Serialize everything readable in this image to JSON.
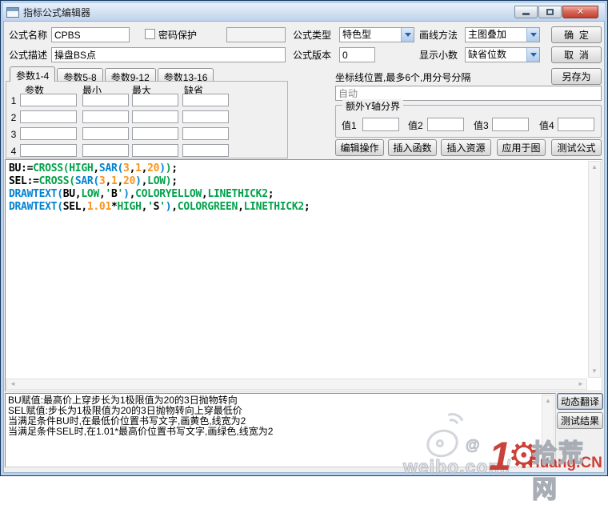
{
  "window": {
    "title": "指标公式编辑器"
  },
  "form": {
    "name_label": "公式名称",
    "name_value": "CPBS",
    "password_label": "密码保护",
    "password_value": "",
    "desc_label": "公式描述",
    "desc_value": "操盘BS点",
    "type_label": "公式类型",
    "type_value": "特色型",
    "draw_label": "画线方法",
    "draw_value": "主图叠加",
    "version_label": "公式版本",
    "version_value": "0",
    "decimal_label": "显示小数",
    "decimal_value": "缺省位数",
    "ok_label": "确  定",
    "cancel_label": "取  消",
    "saveas_label": "另存为"
  },
  "param_tabs": [
    {
      "label": "参数1-4",
      "active": true
    },
    {
      "label": "参数5-8",
      "active": false
    },
    {
      "label": "参数9-12",
      "active": false
    },
    {
      "label": "参数13-16",
      "active": false
    }
  ],
  "params": {
    "headers": [
      "参数",
      "最小",
      "最大",
      "缺省"
    ],
    "rows": [
      {
        "index": "1",
        "values": [
          "",
          "",
          "",
          ""
        ]
      },
      {
        "index": "2",
        "values": [
          "",
          "",
          "",
          ""
        ]
      },
      {
        "index": "3",
        "values": [
          "",
          "",
          "",
          ""
        ]
      },
      {
        "index": "4",
        "values": [
          "",
          "",
          "",
          ""
        ]
      }
    ]
  },
  "coord": {
    "hint": "坐标线位置,最多6个,用分号分隔",
    "value": "自动"
  },
  "ybound": {
    "title": "额外Y轴分界",
    "fields": [
      {
        "label": "值1",
        "value": ""
      },
      {
        "label": "值2",
        "value": ""
      },
      {
        "label": "值3",
        "value": ""
      },
      {
        "label": "值4",
        "value": ""
      }
    ]
  },
  "actions": [
    "编辑操作",
    "插入函数",
    "插入资源",
    "应用于图",
    "测试公式"
  ],
  "code": {
    "lines": [
      [
        {
          "c": "k",
          "t": "BU:="
        },
        {
          "c": "g",
          "t": "CROSS(HIGH"
        },
        {
          "c": "k",
          "t": ","
        },
        {
          "c": "b",
          "t": "SAR("
        },
        {
          "c": "o",
          "t": "3"
        },
        {
          "c": "k",
          "t": ","
        },
        {
          "c": "o",
          "t": "1"
        },
        {
          "c": "k",
          "t": ","
        },
        {
          "c": "o",
          "t": "20"
        },
        {
          "c": "b",
          "t": ")"
        },
        {
          "c": "g",
          "t": ")"
        },
        {
          "c": "k",
          "t": ";"
        }
      ],
      [
        {
          "c": "k",
          "t": "SEL:="
        },
        {
          "c": "g",
          "t": "CROSS("
        },
        {
          "c": "b",
          "t": "SAR("
        },
        {
          "c": "o",
          "t": "3"
        },
        {
          "c": "k",
          "t": ","
        },
        {
          "c": "o",
          "t": "1"
        },
        {
          "c": "k",
          "t": ","
        },
        {
          "c": "o",
          "t": "20"
        },
        {
          "c": "b",
          "t": ")"
        },
        {
          "c": "k",
          "t": ","
        },
        {
          "c": "g",
          "t": "LOW)"
        },
        {
          "c": "k",
          "t": ";"
        }
      ],
      [
        {
          "c": "b",
          "t": "DRAWTEXT("
        },
        {
          "c": "k",
          "t": "BU,"
        },
        {
          "c": "g",
          "t": "LOW"
        },
        {
          "c": "k",
          "t": ","
        },
        {
          "c": "g",
          "t": "'"
        },
        {
          "c": "k",
          "t": "B"
        },
        {
          "c": "g",
          "t": "'"
        },
        {
          "c": "b",
          "t": ")"
        },
        {
          "c": "k",
          "t": ","
        },
        {
          "c": "g",
          "t": "COLORYELLOW"
        },
        {
          "c": "k",
          "t": ","
        },
        {
          "c": "g",
          "t": "LINETHICK2"
        },
        {
          "c": "k",
          "t": ";"
        }
      ],
      [
        {
          "c": "b",
          "t": "DRAWTEXT("
        },
        {
          "c": "k",
          "t": "SEL,"
        },
        {
          "c": "o",
          "t": "1.01"
        },
        {
          "c": "k",
          "t": "*"
        },
        {
          "c": "g",
          "t": "HIGH"
        },
        {
          "c": "k",
          "t": ","
        },
        {
          "c": "g",
          "t": "'"
        },
        {
          "c": "k",
          "t": "S"
        },
        {
          "c": "g",
          "t": "'"
        },
        {
          "c": "b",
          "t": ")"
        },
        {
          "c": "k",
          "t": ","
        },
        {
          "c": "g",
          "t": "COLORGREEN"
        },
        {
          "c": "k",
          "t": ","
        },
        {
          "c": "g",
          "t": "LINETHICK2"
        },
        {
          "c": "k",
          "t": ";"
        }
      ]
    ]
  },
  "description": {
    "lines": [
      "BU赋值:最高价上穿步长为1极限值为20的3日抛物转向",
      "SEL赋值:步长为1极限值为20的3日抛物转向上穿最低价",
      "当满足条件BU时,在最低价位置书写文字,画黄色,线宽为2",
      "当满足条件SEL时,在1.01*最高价位置书写文字,画绿色,线宽为2"
    ]
  },
  "bottom_buttons": [
    {
      "label": "动态翻译",
      "name": "dynamic-translate-button",
      "focused": true
    },
    {
      "label": "测试结果",
      "name": "test-result-button",
      "focused": false
    }
  ],
  "watermark": {
    "weibo_text": "weibo.com/",
    "at": "@",
    "ten": "1",
    "gear": "⚙",
    "huang": "Huang.CN",
    "site": "拾荒网"
  },
  "colors": {
    "code_black": "#000000",
    "code_green": "#00A24A",
    "code_blue": "#0082D1",
    "code_orange": "#F7941D",
    "close_button": "#c0402f",
    "watermark_red": "#c5342b",
    "titlebar": "#d4e2f3"
  }
}
